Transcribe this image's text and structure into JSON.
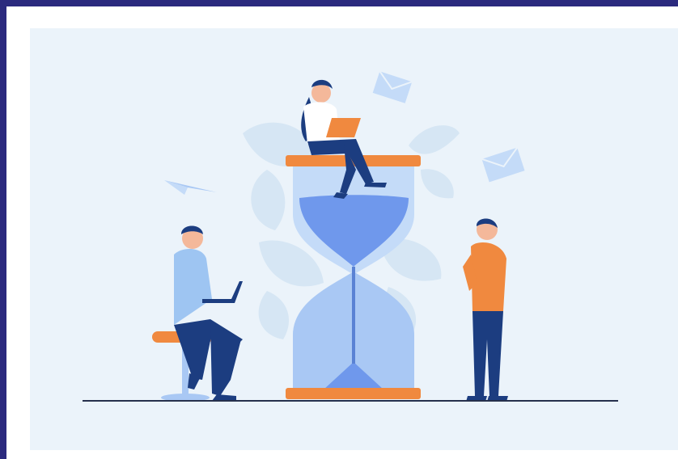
{
  "illustration": {
    "colors": {
      "frame": "#2b2a7e",
      "card": "#ffffff",
      "panel": "#ebf3fa",
      "leaf": "#d6e6f4",
      "glass": "#a9c8f4",
      "glass_light": "#c4dbf8",
      "sand": "#6f98ec",
      "orange": "#f0893f",
      "navy": "#1c3d80",
      "shirt_light": "#9ec5f2",
      "ground": "#26304c"
    },
    "elements": [
      "hourglass",
      "woman-with-laptop",
      "man-with-laptop-on-stool",
      "standing-man",
      "paper-plane",
      "envelope",
      "envelope",
      "tropical-leaves"
    ]
  }
}
